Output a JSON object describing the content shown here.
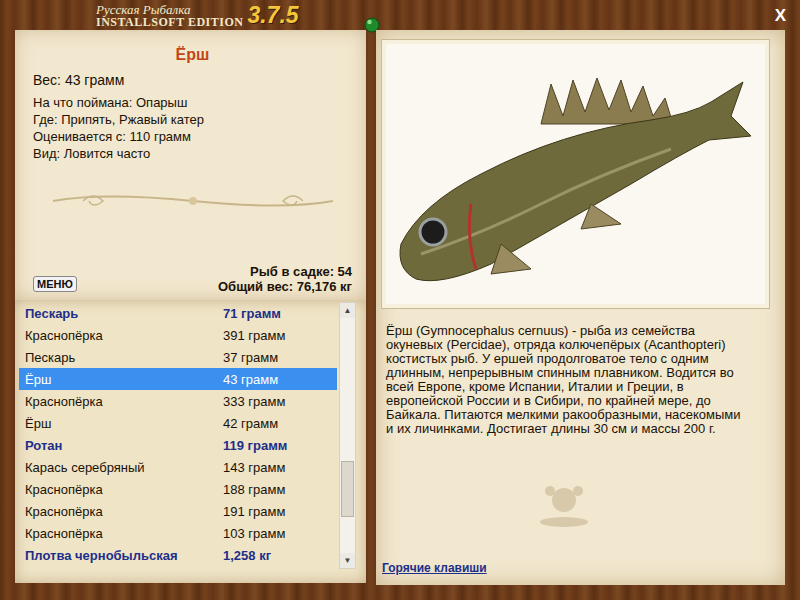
{
  "window": {
    "logo_line1": "Русская Рыбалка",
    "logo_line2": "INSTALLSOFT EDITION",
    "version": "3.7.5",
    "close": "X"
  },
  "fish": {
    "name": "Ёрш",
    "weight": "Вес: 43 грамм",
    "fields": [
      "На что поймана: Опарыш",
      "Где: Припять, Ржавый катер",
      "Оценивается с: 110 грамм",
      "Вид: Ловится часто"
    ]
  },
  "menu": "МЕНЮ",
  "keepnet": {
    "count": "Рыб в садке: 54",
    "total": "Общий вес: 76,176 кг"
  },
  "list": {
    "rows": [
      {
        "name": "Пескарь",
        "weight": "71 грамм",
        "trophy": true,
        "selected": false
      },
      {
        "name": "Краснопёрка",
        "weight": "391 грамм",
        "trophy": false,
        "selected": false
      },
      {
        "name": "Пескарь",
        "weight": "37 грамм",
        "trophy": false,
        "selected": false
      },
      {
        "name": "Ёрш",
        "weight": "43 грамм",
        "trophy": false,
        "selected": true
      },
      {
        "name": "Краснопёрка",
        "weight": "333 грамм",
        "trophy": false,
        "selected": false
      },
      {
        "name": "Ёрш",
        "weight": "42 грамм",
        "trophy": false,
        "selected": false
      },
      {
        "name": "Ротан",
        "weight": "119 грамм",
        "trophy": true,
        "selected": false
      },
      {
        "name": "Карась серебряный",
        "weight": "143 грамм",
        "trophy": false,
        "selected": false
      },
      {
        "name": "Краснопёрка",
        "weight": "188 грамм",
        "trophy": false,
        "selected": false
      },
      {
        "name": "Краснопёрка",
        "weight": "191 грамм",
        "trophy": false,
        "selected": false
      },
      {
        "name": "Краснопёрка",
        "weight": "103 грамм",
        "trophy": false,
        "selected": false
      },
      {
        "name": "Плотва чернобыльская",
        "weight": "1,258 кг",
        "trophy": true,
        "selected": false
      }
    ],
    "scrollbar": {
      "up": "▲",
      "down": "▼",
      "position": 0.8,
      "size": 0.24
    }
  },
  "description": "Ёрш (Gymnocephalus cernuus) - рыба из семейства окуневых (Percidae), отряда колючепёрых (Acanthopteri) костистых рыб. У ершей продолговатое тело с одним длинным, непрерывным спинным плавником. Водится во всей Европе, кроме Испании, Италии и Греции, в европейской России и в Сибири, по крайней мере, до Байкала. Питаются мелкими ракообразными, насекомыми и их личинками. Достигает длины 30 см и массы 200 г.",
  "hotkeys": "Горячие клавиши"
}
